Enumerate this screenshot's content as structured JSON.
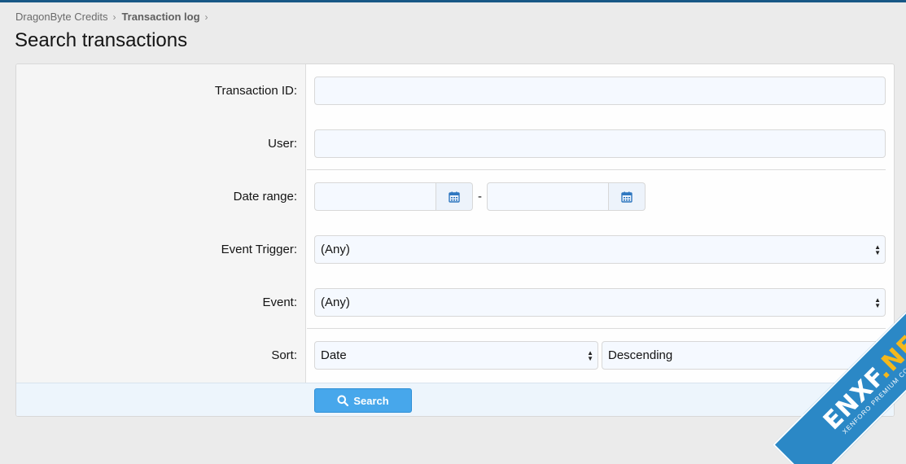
{
  "breadcrumb": {
    "items": [
      "DragonByte Credits",
      "Transaction log"
    ],
    "separator": "›"
  },
  "page": {
    "title": "Search transactions"
  },
  "form": {
    "transaction_id": {
      "label": "Transaction ID:",
      "value": ""
    },
    "user": {
      "label": "User:",
      "value": ""
    },
    "date_range": {
      "label": "Date range:",
      "start": "",
      "end": "",
      "separator": "-"
    },
    "event_trigger": {
      "label": "Event Trigger:",
      "selected": "(Any)"
    },
    "event": {
      "label": "Event:",
      "selected": "(Any)"
    },
    "sort": {
      "label": "Sort:",
      "field_selected": "Date",
      "order_selected": "Descending"
    }
  },
  "footer": {
    "search_label": "Search"
  },
  "watermark": {
    "main_a": "ENXF",
    "main_b": ".NET",
    "sub": "XENFORO PREMIUM COMMUNITY"
  },
  "colors": {
    "accent": "#47a7eb",
    "topline": "#185886",
    "watermark_blue": "#2b88c6",
    "watermark_yellow": "#f5b81b"
  },
  "icons": {
    "calendar": "calendar-icon",
    "search": "search-icon",
    "select": "select-arrows-icon"
  }
}
